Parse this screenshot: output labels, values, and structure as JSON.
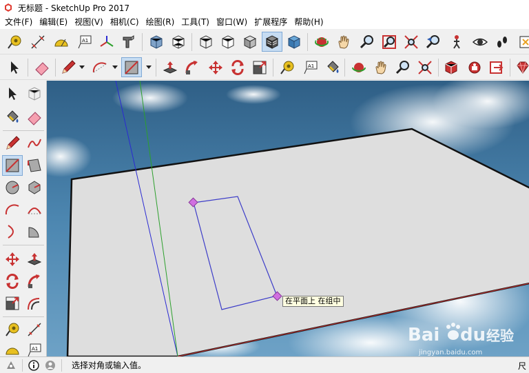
{
  "window": {
    "title": "无标题 - SketchUp Pro 2017"
  },
  "menubar": {
    "items": [
      "文件(F)",
      "编辑(E)",
      "视图(V)",
      "相机(C)",
      "绘图(R)",
      "工具(T)",
      "窗口(W)",
      "扩展程序",
      "帮助(H)"
    ]
  },
  "toolbar_icons": {
    "text_tool_label": "A1"
  },
  "viewport": {
    "tooltip": "在平面上  在组中"
  },
  "watermark": {
    "logo_text": "Bai",
    "logo_text2": "du",
    "chinese": "经验",
    "url": "jingyan.baidu.com"
  },
  "statusbar": {
    "prompt": "选择对角或输入值。",
    "measure_label": "尺"
  },
  "colors": {
    "active_button_bg": "#c6dcf2",
    "plane_fill": "#dedede",
    "rectangle_stroke": "#3c3cc8",
    "axis_blue": "#2a2ad2",
    "axis_green": "#2ca02c",
    "axis_red": "#c83232",
    "endpoint_marker": "#d070e0"
  }
}
